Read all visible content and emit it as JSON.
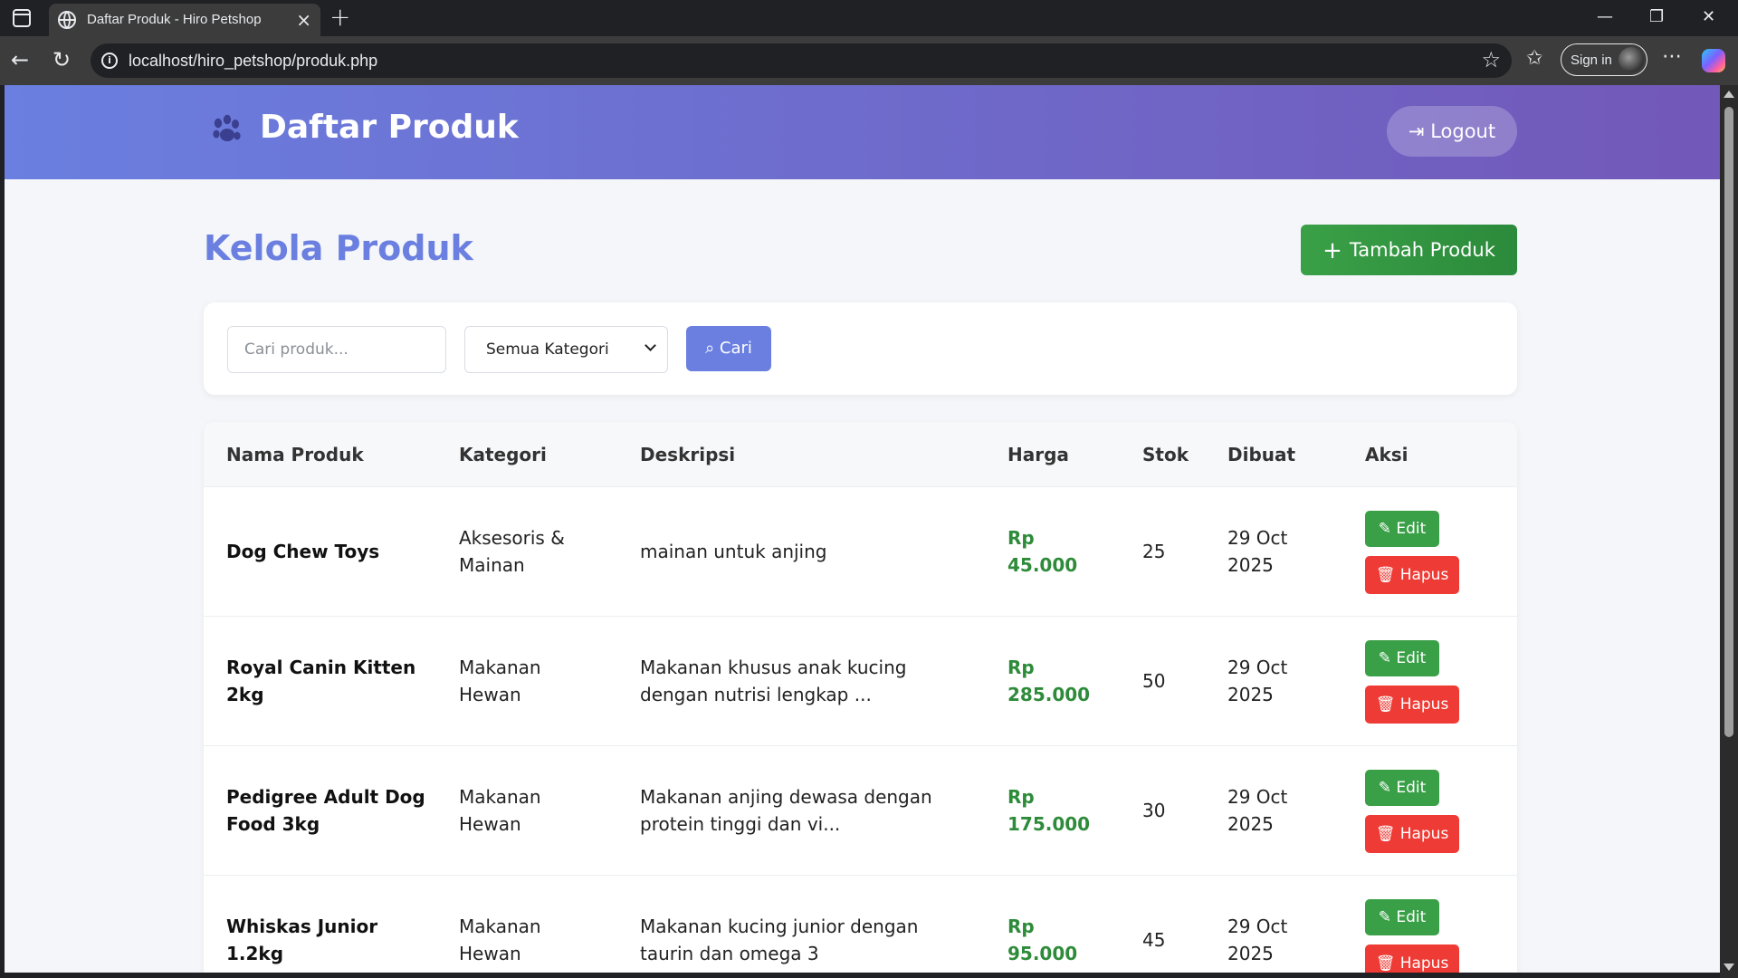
{
  "browser": {
    "tab_title": "Daftar Produk - Hiro Petshop",
    "url": "localhost/hiro_petshop/produk.php",
    "signin_label": "Sign in"
  },
  "header": {
    "title": "Daftar Produk",
    "logout_label": "Logout",
    "brand_icon": "paw-icon"
  },
  "main": {
    "heading": "Kelola Produk",
    "add_button_label": "Tambah Produk"
  },
  "filters": {
    "search_placeholder": "Cari produk...",
    "search_value": "",
    "category_selected": "Semua Kategori",
    "search_button_label": "Cari"
  },
  "table": {
    "columns": [
      "Nama Produk",
      "Kategori",
      "Deskripsi",
      "Harga",
      "Stok",
      "Dibuat",
      "Aksi"
    ],
    "rows": [
      {
        "name": [
          "Dog Chew Toys"
        ],
        "category": [
          "Aksesoris &",
          "Mainan"
        ],
        "description": [
          "mainan untuk anjing"
        ],
        "price": [
          "Rp",
          "45.000"
        ],
        "stock": "25",
        "created": [
          "29 Oct",
          "2025"
        ]
      },
      {
        "name": [
          "Royal Canin Kitten",
          "2kg"
        ],
        "category": [
          "Makanan",
          "Hewan"
        ],
        "description": [
          "Makanan khusus anak kucing",
          "dengan nutrisi lengkap ..."
        ],
        "price": [
          "Rp",
          "285.000"
        ],
        "stock": "50",
        "created": [
          "29 Oct",
          "2025"
        ]
      },
      {
        "name": [
          "Pedigree Adult Dog",
          "Food 3kg"
        ],
        "category": [
          "Makanan",
          "Hewan"
        ],
        "description": [
          "Makanan anjing dewasa dengan",
          "protein tinggi dan vi..."
        ],
        "price": [
          "Rp",
          "175.000"
        ],
        "stock": "30",
        "created": [
          "29 Oct",
          "2025"
        ]
      },
      {
        "name": [
          "Whiskas Junior",
          "1.2kg"
        ],
        "category": [
          "Makanan",
          "Hewan"
        ],
        "description": [
          "Makanan kucing junior dengan",
          "taurin dan omega 3"
        ],
        "price": [
          "Rp",
          "95.000"
        ],
        "stock": "45",
        "created": [
          "29 Oct",
          "2025"
        ]
      }
    ],
    "edit_label": "Edit",
    "delete_label": "Hapus"
  },
  "colors": {
    "header_gradient_start": "#6a7fe0",
    "header_gradient_end": "#7258b8",
    "accent": "#6a7fe0",
    "success": "#3aa047",
    "danger": "#ef3b35",
    "price": "#2e8b3a"
  }
}
